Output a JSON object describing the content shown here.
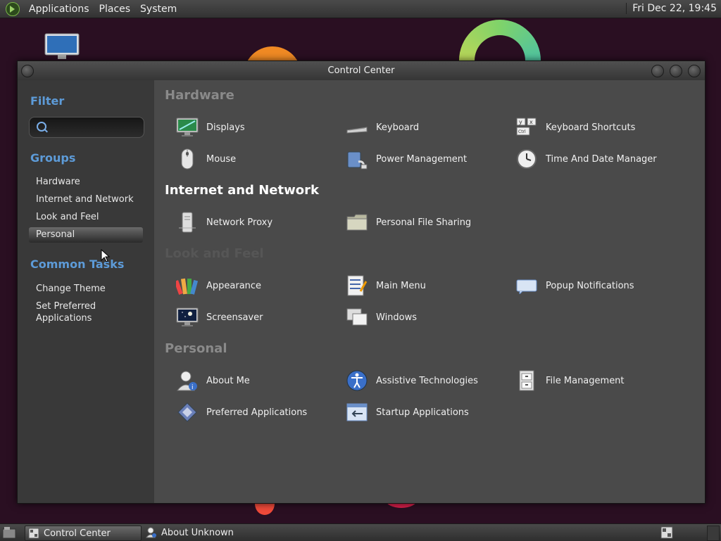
{
  "top_panel": {
    "menus": [
      "Applications",
      "Places",
      "System"
    ],
    "clock": "Fri Dec 22, 19:45"
  },
  "window": {
    "title": "Control Center"
  },
  "sidebar": {
    "filter_heading": "Filter",
    "search_placeholder": "",
    "groups_heading": "Groups",
    "groups": [
      "Hardware",
      "Internet and Network",
      "Look and Feel",
      "Personal"
    ],
    "selected_group": "Personal",
    "tasks_heading": "Common Tasks",
    "tasks": [
      "Change Theme",
      "Set Preferred Applications"
    ]
  },
  "main": {
    "groups": [
      {
        "title": "Hardware",
        "items": [
          {
            "label": "Displays",
            "icon": "display-icon"
          },
          {
            "label": "Keyboard",
            "icon": "keyboard-icon"
          },
          {
            "label": "Keyboard Shortcuts",
            "icon": "keyboard-shortcuts-icon"
          },
          {
            "label": "Mouse",
            "icon": "mouse-icon"
          },
          {
            "label": "Power Management",
            "icon": "power-management-icon"
          },
          {
            "label": "Time And Date Manager",
            "icon": "clock-icon"
          }
        ]
      },
      {
        "title": "Internet and Network",
        "items": [
          {
            "label": "Network Proxy",
            "icon": "network-proxy-icon"
          },
          {
            "label": "Personal File Sharing",
            "icon": "folder-sharing-icon"
          }
        ]
      },
      {
        "title": "Look and Feel",
        "items": [
          {
            "label": "Appearance",
            "icon": "appearance-icon"
          },
          {
            "label": "Main Menu",
            "icon": "main-menu-icon"
          },
          {
            "label": "Popup Notifications",
            "icon": "notification-icon"
          },
          {
            "label": "Screensaver",
            "icon": "screensaver-icon"
          },
          {
            "label": "Windows",
            "icon": "windows-icon"
          }
        ]
      },
      {
        "title": "Personal",
        "items": [
          {
            "label": "About Me",
            "icon": "about-me-icon"
          },
          {
            "label": "Assistive Technologies",
            "icon": "accessibility-icon"
          },
          {
            "label": "File Management",
            "icon": "file-cabinet-icon"
          },
          {
            "label": "Preferred Applications",
            "icon": "preferred-apps-icon"
          },
          {
            "label": "Startup Applications",
            "icon": "startup-apps-icon"
          }
        ]
      }
    ]
  },
  "taskbar": {
    "tasks": [
      {
        "label": "Control Center",
        "active": true
      },
      {
        "label": "About Unknown",
        "active": false
      }
    ]
  },
  "colors": {
    "accent": "#5d9bd8",
    "desktop": "#2a0f22",
    "active_heading": "#ffffff",
    "dim_heading": "#8a8a8a",
    "faint_heading": "#565656"
  }
}
